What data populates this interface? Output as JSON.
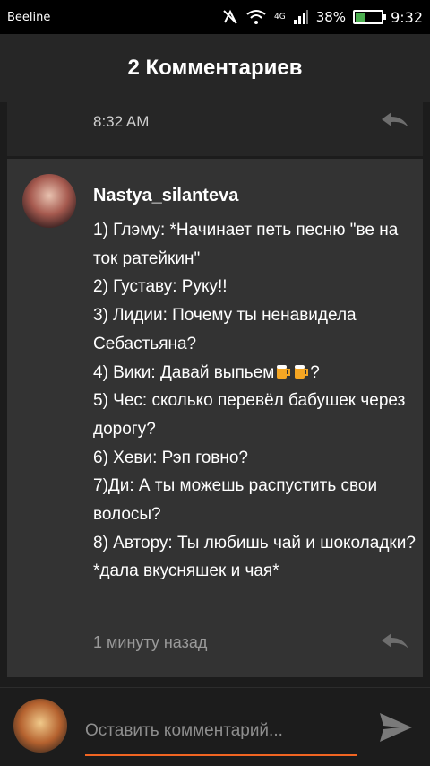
{
  "status_bar": {
    "carrier": "Beeline",
    "network": "4G",
    "battery_percent": "38%",
    "battery_level": 0.38,
    "time": "9:32",
    "icons": [
      "nfc-icon",
      "wifi-icon",
      "signal-icon",
      "battery-charging-icon"
    ]
  },
  "header": {
    "title": "2 Комментариев"
  },
  "previous_comment": {
    "time": "8:32 AM",
    "reply_icon": "reply-icon"
  },
  "comment": {
    "username": "Nastya_silanteva",
    "lines": [
      "1) Глэму: *Начинает петь песню \"ве на ток ратейкин\"",
      "2) Густаву: Руку!!",
      "3) Лидии: Почему ты ненавидела Себастьяна?",
      "4) Вики: Давай выпьем",
      "5) Чес: сколько перевёл бабушек через дорогу?",
      "6) Хеви: Рэп говно?",
      "7)Ди: А ты можешь распустить свои волосы?",
      "8) Автору: Ты любишь чай и шоколадки? *дала вкусняшек и чая*"
    ],
    "line4_suffix": "?",
    "emoji": "beer-mug-icon",
    "timestamp": "1 минуту назад",
    "reply_icon": "reply-icon"
  },
  "input": {
    "placeholder": "Оставить комментарий...",
    "send_icon": "send-icon",
    "accent_color": "#f16522"
  }
}
